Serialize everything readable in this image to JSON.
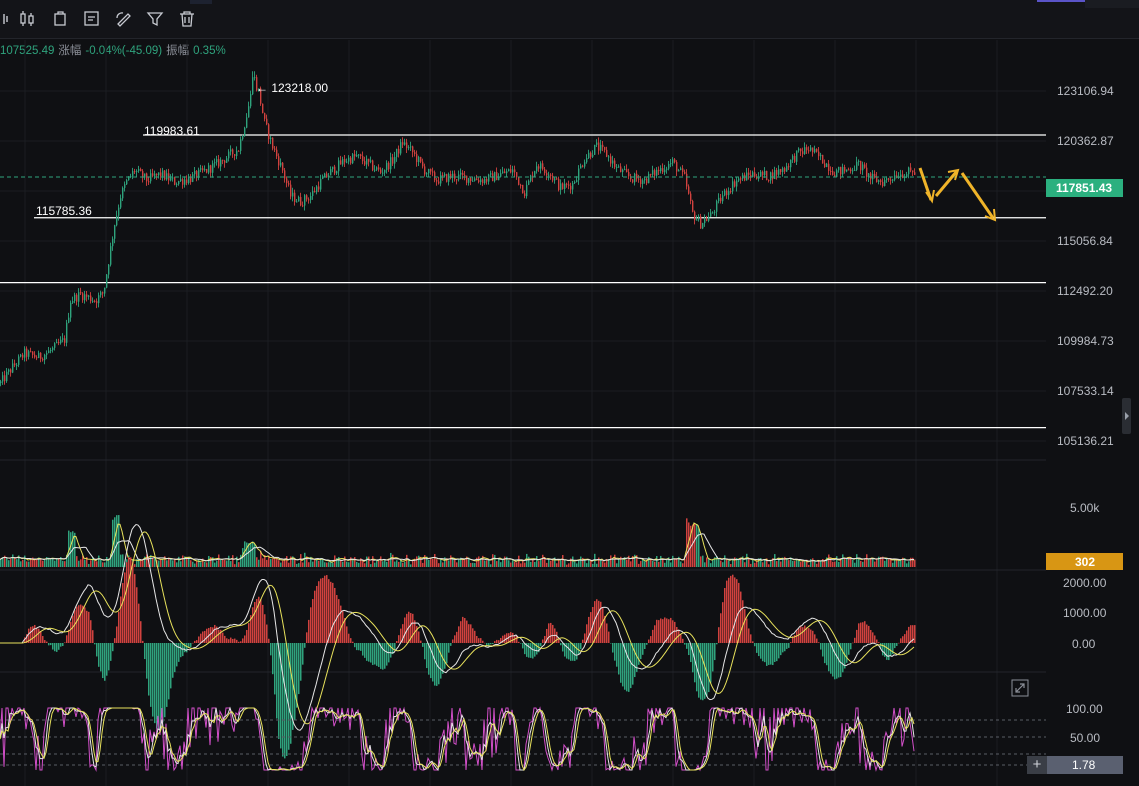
{
  "toolbar": {
    "icons": [
      "candlestick-icon",
      "bar-chart-icon",
      "copy-icon",
      "note-icon",
      "draw-icon",
      "filter-icon",
      "trash-icon"
    ]
  },
  "infobar": {
    "close_value": "107525.49",
    "change_label": "涨幅",
    "change_value": "-0.04%(-45.09)",
    "amplitude_label": "振幅",
    "amplitude_value": "0.35%"
  },
  "price_axis": {
    "ticks": [
      "123106.94",
      "120362.87",
      "115056.84",
      "112492.20",
      "109984.73",
      "107533.14",
      "105136.21"
    ],
    "current_price": "117851.43"
  },
  "annotations": {
    "high_label": "← 123218.00",
    "upper_line_label": "119983.61",
    "lower_line_label": "115785.36"
  },
  "volume": {
    "axis_label": "5.00k",
    "current_value": "302"
  },
  "macd": {
    "ticks": [
      "2000.00",
      "1000.00",
      "0.00"
    ]
  },
  "oscillator": {
    "ticks": [
      "100.00",
      "50.00"
    ],
    "current_value": "1.78"
  },
  "colors": {
    "up": "#2fa37d",
    "down": "#d1423f",
    "price_badge": "#2bb07f",
    "volume_badge": "#d89614",
    "arrow": "#f0b429",
    "ma_yellow": "#e8e25c",
    "ma_white": "#e6e6e6",
    "osc_pink": "#d24fc9"
  },
  "chart_data": {
    "type": "candlestick",
    "y_range": [
      104000,
      124500
    ],
    "high": 123218.0,
    "horizontal_levels": [
      119983.61,
      115785.36,
      112492.2,
      105136.21
    ],
    "current_price": 117851.43,
    "close_path": [
      [
        0,
        107400
      ],
      [
        12,
        108200
      ],
      [
        24,
        108900
      ],
      [
        38,
        108700
      ],
      [
        52,
        109100
      ],
      [
        64,
        109600
      ],
      [
        70,
        111600
      ],
      [
        80,
        111900
      ],
      [
        95,
        111600
      ],
      [
        103,
        112000
      ],
      [
        108,
        113600
      ],
      [
        114,
        115500
      ],
      [
        120,
        116900
      ],
      [
        126,
        117600
      ],
      [
        134,
        118200
      ],
      [
        146,
        117700
      ],
      [
        160,
        118000
      ],
      [
        174,
        117600
      ],
      [
        190,
        117800
      ],
      [
        206,
        118200
      ],
      [
        222,
        118700
      ],
      [
        238,
        119300
      ],
      [
        247,
        121200
      ],
      [
        253,
        122700
      ],
      [
        258,
        122200
      ],
      [
        264,
        120600
      ],
      [
        272,
        119400
      ],
      [
        282,
        118200
      ],
      [
        290,
        116900
      ],
      [
        300,
        116600
      ],
      [
        310,
        116900
      ],
      [
        320,
        117600
      ],
      [
        332,
        118200
      ],
      [
        344,
        118700
      ],
      [
        356,
        118900
      ],
      [
        368,
        118500
      ],
      [
        380,
        118100
      ],
      [
        392,
        118700
      ],
      [
        402,
        119600
      ],
      [
        412,
        119100
      ],
      [
        424,
        118200
      ],
      [
        436,
        117700
      ],
      [
        452,
        117900
      ],
      [
        468,
        117800
      ],
      [
        484,
        117700
      ],
      [
        500,
        118000
      ],
      [
        512,
        118200
      ],
      [
        524,
        117100
      ],
      [
        536,
        118500
      ],
      [
        548,
        118100
      ],
      [
        560,
        117300
      ],
      [
        572,
        117500
      ],
      [
        584,
        118800
      ],
      [
        596,
        119400
      ],
      [
        606,
        119000
      ],
      [
        616,
        118300
      ],
      [
        630,
        117800
      ],
      [
        644,
        117700
      ],
      [
        658,
        118200
      ],
      [
        672,
        118600
      ],
      [
        684,
        117800
      ],
      [
        692,
        116000
      ],
      [
        700,
        115500
      ],
      [
        710,
        115900
      ],
      [
        722,
        116900
      ],
      [
        736,
        117700
      ],
      [
        752,
        118000
      ],
      [
        768,
        117900
      ],
      [
        784,
        118300
      ],
      [
        796,
        119000
      ],
      [
        808,
        119300
      ],
      [
        820,
        118800
      ],
      [
        834,
        118100
      ],
      [
        846,
        118200
      ],
      [
        858,
        118500
      ],
      [
        870,
        117800
      ],
      [
        882,
        117600
      ],
      [
        896,
        118000
      ],
      [
        912,
        118100
      ]
    ]
  }
}
